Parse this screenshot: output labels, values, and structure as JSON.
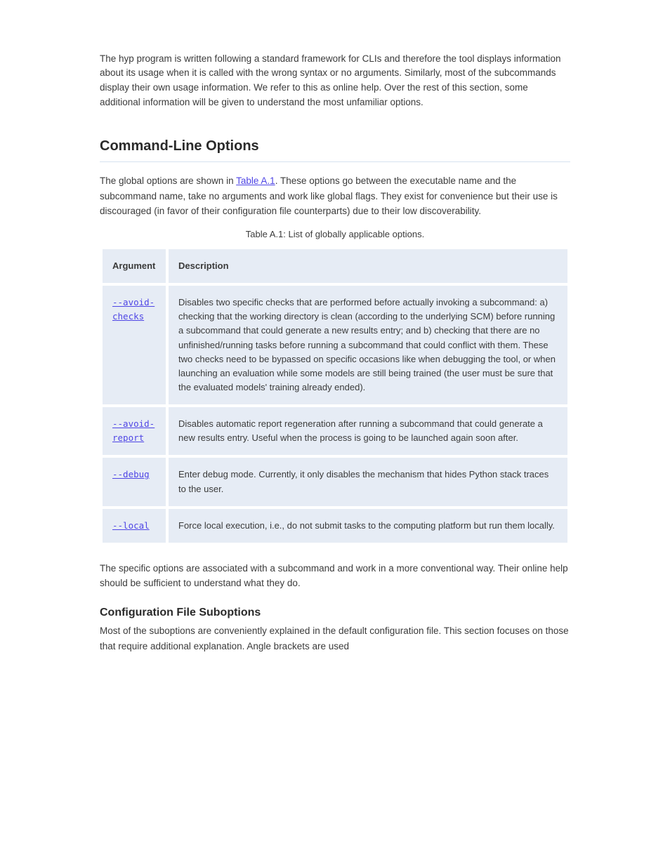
{
  "intro": "The hyp program is written following a standard framework for CLIs and therefore the tool displays information about its usage when it is called with the wrong syntax or no arguments. Similarly, most of the subcommands display their own usage information. We refer to this as online help. Over the rest of this section, some additional information will be given to understand the most unfamiliar options.",
  "heading_cli": "Command-Line Options",
  "global_options": {
    "p1_pre": "The global options are shown in ",
    "link_text": "Table A.1",
    "p1_post": ". These options go between the executable name and the subcommand name, take no arguments and work like global flags. They exist for convenience but their use is discouraged (in favor of their configuration file counterparts) due to their low discoverability."
  },
  "table": {
    "caption": "Table A.1: List of globally applicable options.",
    "header": {
      "arg": "Argument",
      "desc": "Description"
    },
    "rows": [
      {
        "arg_link": "--avoid-checks",
        "desc": "Disables two specific checks that are performed before actually invoking a subcommand: a) checking that the working directory is clean (according to the underlying SCM) before running a subcommand that could generate a new results entry; and b) checking that there are no unfinished/running tasks before running a subcommand that could conflict with them. These two checks need to be bypassed on specific occasions like when debugging the tool, or when launching an evaluation while some models are still being trained (the user must be sure that the evaluated models' training already ended)."
      },
      {
        "arg_link": "--avoid-report",
        "desc": "Disables automatic report regeneration after running a subcommand that could generate a new results entry. Useful when the process is going to be launched again soon after."
      },
      {
        "arg_link": "--debug",
        "desc": "Enter debug mode. Currently, it only disables the mechanism that hides Python stack traces to the user."
      },
      {
        "arg_link": "--local",
        "desc": "Force local execution, i.e., do not submit tasks to the computing platform but run them locally."
      }
    ]
  },
  "continuation": "The specific options are associated with a subcommand and work in a more conventional way. Their online help should be sufficient to understand what they do.",
  "heading_conf": "Configuration File Suboptions",
  "footer": "Most of the suboptions are conveniently explained in the default configuration file. This section focuses on those that require additional explanation. Angle brackets are used"
}
